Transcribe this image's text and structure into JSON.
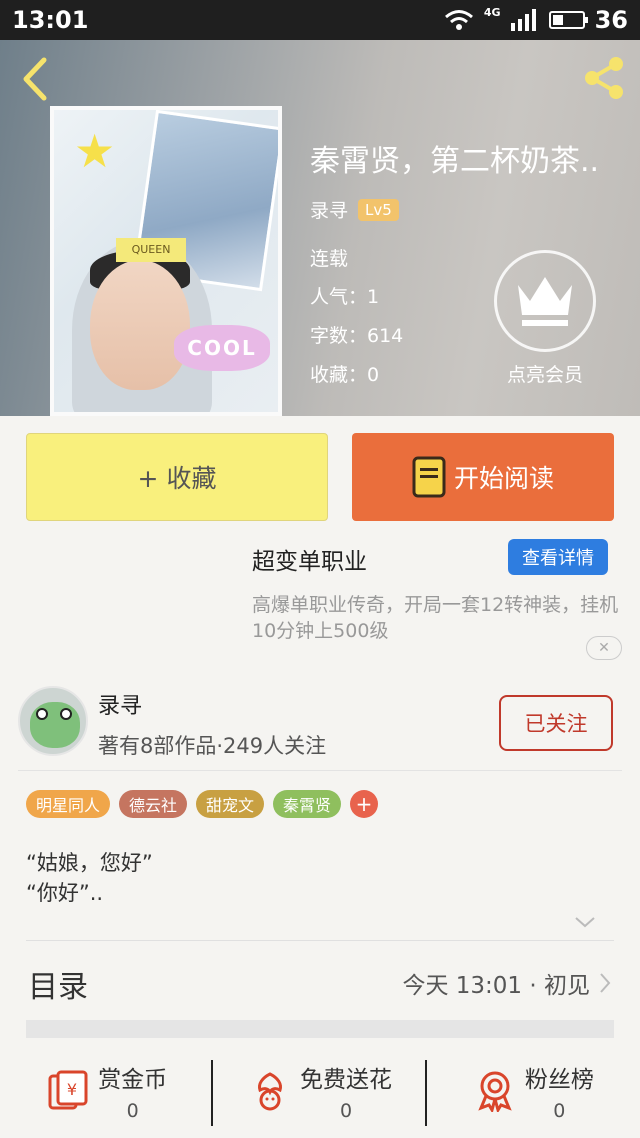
{
  "status_bar": {
    "time": "13:01",
    "network": "4G",
    "battery": "36"
  },
  "book": {
    "title": "秦霄贤，第二杯奶茶..",
    "author": "录寻",
    "level": "Lv5",
    "status": "连载",
    "popularity": "人气：1",
    "words": "字数：614",
    "favorites": "收藏：0"
  },
  "vip": {
    "label": "点亮会员"
  },
  "actions": {
    "favorite": "+ 收藏",
    "read": "开始阅读"
  },
  "ad": {
    "title": "超变单职业",
    "button": "查看详情",
    "description": "高爆单职业传奇，开局一套12转神装，挂机10分钟上500级"
  },
  "author_card": {
    "name": "录寻",
    "info": "著有8部作品·249人关注",
    "follow_label": "已关注"
  },
  "tags": [
    {
      "label": "明星同人",
      "color": "#f0a64a"
    },
    {
      "label": "德云社",
      "color": "#c57560"
    },
    {
      "label": "甜宠文",
      "color": "#c8a042"
    },
    {
      "label": "秦霄贤",
      "color": "#8fbf5e"
    }
  ],
  "tag_add": "+",
  "intro": {
    "line1": "“姑娘，您好”",
    "line2": "“你好”.."
  },
  "toc": {
    "label": "目录",
    "latest": "今天 13:01 · 初见"
  },
  "bottom_bar": [
    {
      "label": "赏金币",
      "value": "0",
      "icon": "reward-coin-icon"
    },
    {
      "label": "免费送花",
      "value": "0",
      "icon": "flower-icon"
    },
    {
      "label": "粉丝榜",
      "value": "0",
      "icon": "medal-icon"
    }
  ],
  "colors": {
    "accent_orange": "#ea6e3c",
    "fav_yellow": "#f9f07d",
    "follow_red": "#c0392b",
    "ad_blue": "#2e7de0"
  }
}
